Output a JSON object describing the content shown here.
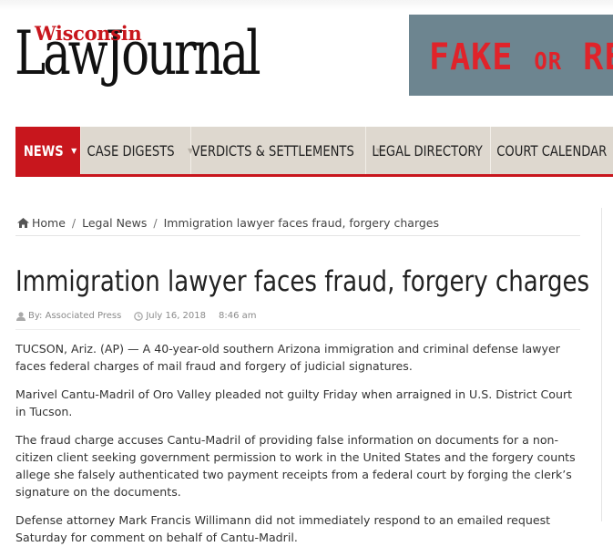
{
  "logo": {
    "small": "Wisconsin",
    "big": "LawJournal"
  },
  "ad": {
    "word1": "FAKE",
    "word2": "OR",
    "word3": "RE"
  },
  "nav": {
    "items": [
      {
        "label": "NEWS",
        "active": true,
        "has_caret": true
      },
      {
        "label": "CASE DIGESTS",
        "has_caret": true
      },
      {
        "label": "VERDICTS & SETTLEMENTS",
        "has_caret": true
      },
      {
        "label": "LEGAL DIRECTORY",
        "has_caret": false
      },
      {
        "label": "COURT CALENDAR",
        "has_caret": false
      }
    ],
    "accent": "#c8161d"
  },
  "breadcrumb": {
    "home": "Home",
    "section": "Legal News",
    "current": "Immigration lawyer faces fraud, forgery charges",
    "separator": "/"
  },
  "article": {
    "title": "Immigration lawyer faces fraud, forgery charges",
    "byline": "By: Associated Press",
    "date": "July 16, 2018",
    "time": "8:46 am",
    "paragraphs": [
      "TUCSON, Ariz. (AP) — A 40-year-old southern Arizona immigration and criminal defense lawyer faces federal charges of mail fraud and forgery of judicial signatures.",
      "Marivel Cantu-Madril of Oro Valley pleaded not guilty Friday when arraigned in U.S. District Court in Tucson.",
      "The fraud charge accuses Cantu-Madril of providing false information on documents for a non-citizen client seeking government permission to work in the United States and the forgery counts allege she falsely authenticated two payment receipts from a federal court by forging the clerk’s signature on the documents.",
      "Defense attorney Mark Francis Willimann did not immediately respond to an emailed request Saturday for comment on behalf of Cantu-Madril."
    ]
  },
  "icons": {
    "home": "home-icon",
    "author": "user-icon",
    "date": "clock-icon",
    "caret": "caret-down-icon"
  }
}
